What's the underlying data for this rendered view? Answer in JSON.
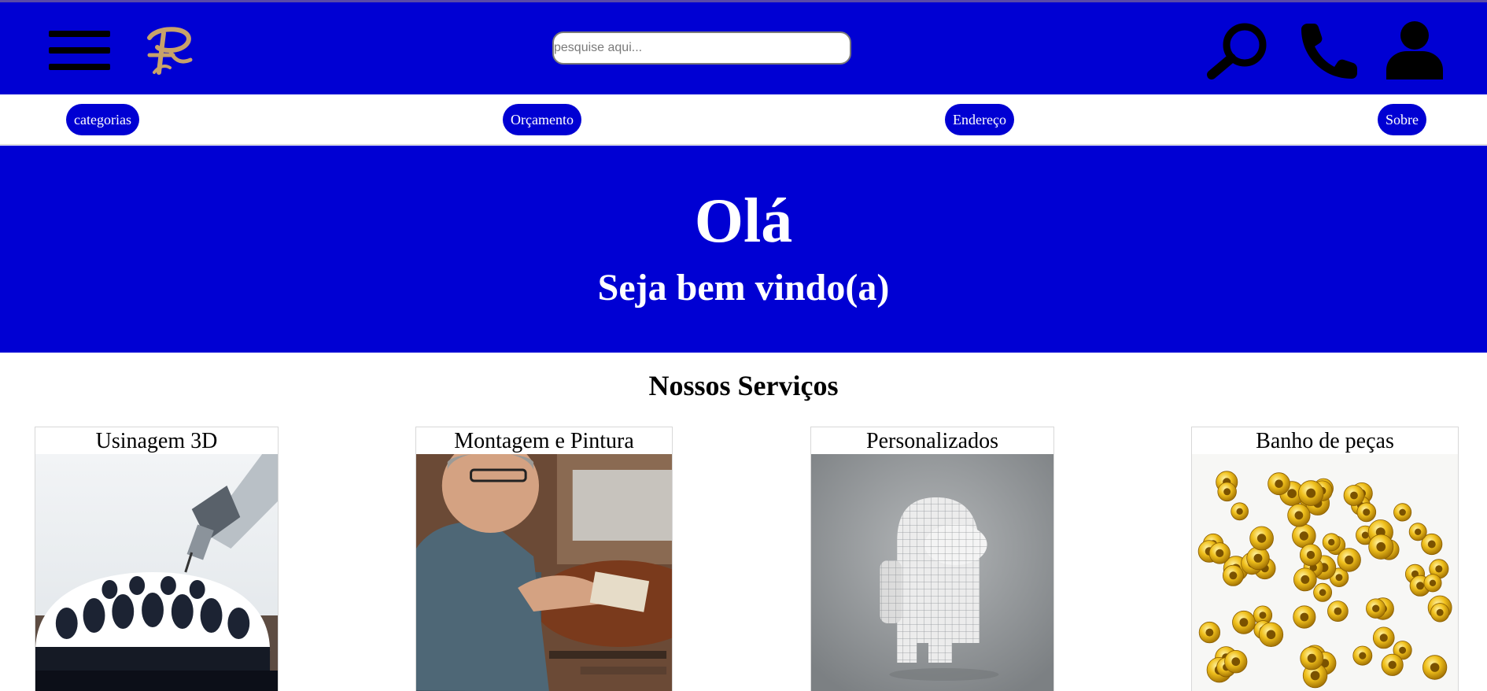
{
  "header": {
    "search_placeholder": "pesquise aqui...",
    "brand_color": "#0000d3",
    "logo_color": "#c8a26a",
    "icons": [
      "menu-icon",
      "logo",
      "search-icon",
      "phone-icon",
      "user-icon"
    ]
  },
  "nav": {
    "items": [
      {
        "label": "categorias"
      },
      {
        "label": "Orçamento"
      },
      {
        "label": "Endereço"
      },
      {
        "label": "Sobre"
      }
    ]
  },
  "hero": {
    "title": "Olá",
    "subtitle": "Seja bem vindo(a)"
  },
  "services": {
    "heading": "Nossos Serviços",
    "cards": [
      {
        "title": "Usinagem 3D",
        "image": "cnc-milling-photo"
      },
      {
        "title": "Montagem e Pintura",
        "image": "craftsman-photo"
      },
      {
        "title": "Personalizados",
        "image": "3d-model-render"
      },
      {
        "title": "Banho de peças",
        "image": "gold-parts-photo"
      }
    ]
  }
}
